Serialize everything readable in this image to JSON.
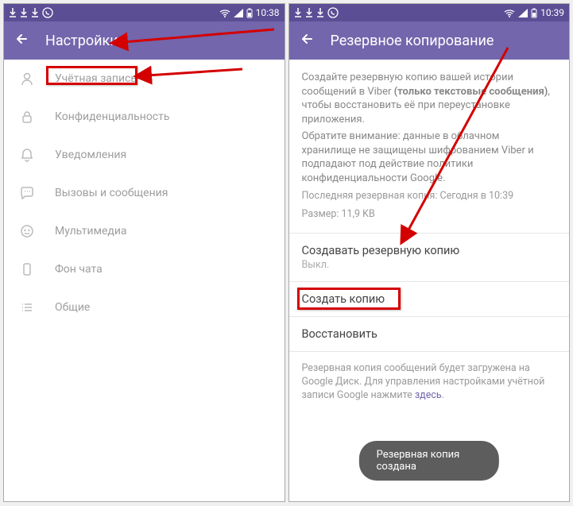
{
  "status": {
    "time": "10:38",
    "time_right": "10:39"
  },
  "left": {
    "title": "Настройки",
    "items": [
      {
        "label": "Учётная запись"
      },
      {
        "label": "Конфиденциальность"
      },
      {
        "label": "Уведомления"
      },
      {
        "label": "Вызовы и сообщения"
      },
      {
        "label": "Мультимедиа"
      },
      {
        "label": "Фон чата"
      },
      {
        "label": "Общие"
      }
    ]
  },
  "right": {
    "title": "Резервное копирование",
    "desc_line1_a": "Создайте резервную копию вашей истории сообщений в Viber ",
    "desc_line1_bold": "(только текстовые сообщения)",
    "desc_line1_b": ", чтобы восстановить её при переустановке приложения.",
    "desc_line2": "Обратите внимание: данные в облачном хранилище не защищены шифрованием Viber и подпадают под действие политики конфиденциальности Google.",
    "last_backup": "Последняя резервная копия: Сегодня в 10:39",
    "size": "Размер: 11,9 KB",
    "create_auto_title": "Создавать резервную копию",
    "create_auto_value": "Выкл.",
    "create_now": "Создать копию",
    "restore": "Восстановить",
    "footer_a": "Резервная копия сообщений будет загружена на Google Диск. Для управления настройками учётной записи Google нажмите ",
    "footer_link": "здесь",
    "footer_b": ".",
    "toast": "Резервная копия создана"
  }
}
